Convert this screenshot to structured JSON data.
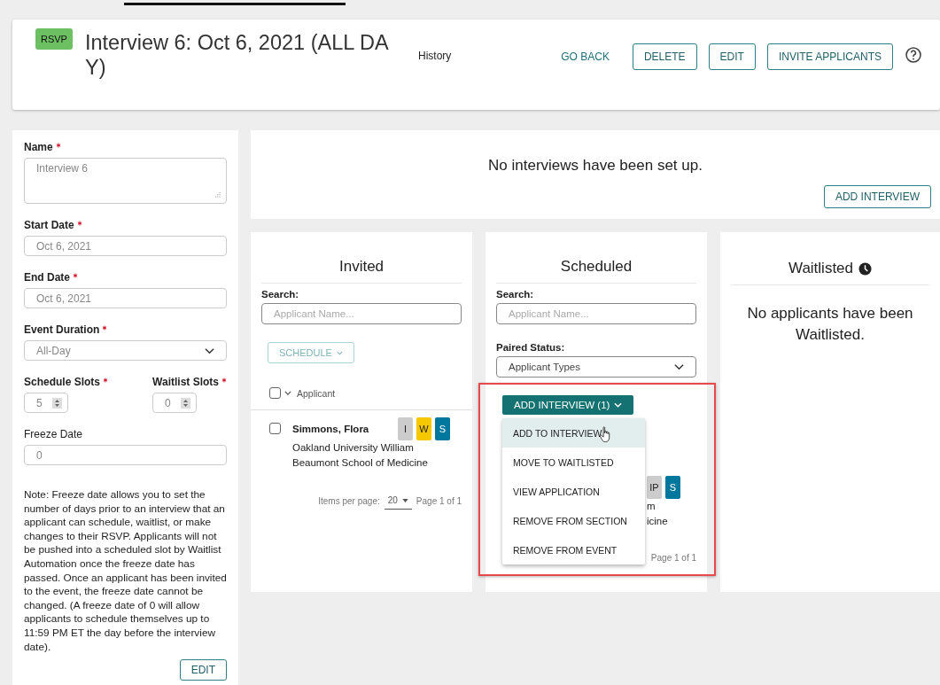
{
  "header": {
    "badge": "RSVP",
    "title": "Interview 6: Oct 6, 2021 (ALL DAY)",
    "history": "History",
    "go_back": "GO BACK",
    "buttons": [
      "DELETE",
      "EDIT",
      "INVITE APPLICANTS"
    ]
  },
  "form": {
    "fields": [
      {
        "kind": "textarea",
        "label": "Name",
        "required": true,
        "value": "Interview 6"
      },
      {
        "kind": "input",
        "label": "Start Date",
        "required": true,
        "value": "Oct 6, 2021"
      },
      {
        "kind": "input",
        "label": "End Date",
        "required": true,
        "value": "Oct 6, 2021"
      },
      {
        "kind": "select",
        "label": "Event Duration",
        "required": true,
        "value": "All-Day"
      }
    ],
    "slots": [
      {
        "label": "Schedule Slots",
        "required": true,
        "value": "5"
      },
      {
        "label": "Waitlist Slots",
        "required": true,
        "value": "0"
      }
    ],
    "freeze": {
      "label": "Freeze Date",
      "value": "0"
    },
    "note": "Note: Freeze date allows you to set the number of days prior to an interview that an applicant can schedule, waitlist, or make changes to their RSVP. Applicants will not be pushed into a scheduled slot by Waitlist Automation once the freeze date has passed. Once an applicant has been invited to the event, the freeze date cannot be changed. (A freeze date of 0 will allow applicants to schedule themselves up to 11:59 PM ET the day before the interview date).",
    "edit": "EDIT"
  },
  "interviews": {
    "message": "No interviews have been set up.",
    "button": "ADD INTERVIEW"
  },
  "invited": {
    "title": "Invited",
    "search_label": "Search:",
    "search_placeholder": "Applicant Name...",
    "schedule_button": "SCHEDULE",
    "column": "Applicant",
    "select_all_checked": false,
    "rows": [
      {
        "name": "Simmons, Flora",
        "school": "Oakland University William Beaumont School of Medicine",
        "checked": false,
        "tags": [
          {
            "text": "I",
            "color": "#cccccc"
          },
          {
            "text": "W",
            "color": "#f5c800"
          },
          {
            "text": "S",
            "color": "#00789e"
          }
        ]
      }
    ],
    "items_per_page_label": "Items per page:",
    "items_per_page": "20",
    "page": "Page 1 of 1"
  },
  "scheduled": {
    "title": "Scheduled",
    "search_label": "Search:",
    "search_placeholder": "Applicant Name...",
    "paired_label": "Paired Status:",
    "paired_value": "Applicant Types",
    "action_button": "ADD INTERVIEW (1)",
    "menu": [
      {
        "label": "ADD TO INTERVIEW",
        "selected": true
      },
      {
        "label": "MOVE TO WAITLISTED",
        "selected": false
      },
      {
        "label": "VIEW APPLICATION",
        "selected": false
      },
      {
        "label": "REMOVE FROM SECTION",
        "selected": false
      },
      {
        "label": "REMOVE FROM EVENT",
        "selected": false
      }
    ],
    "row": {
      "tags": [
        {
          "text": "IP",
          "color": "#cccccc"
        },
        {
          "text": "S",
          "color": "#00789e"
        }
      ],
      "fragments": [
        "m",
        "icine"
      ]
    },
    "page": "Page 1 of 1"
  },
  "waitlisted": {
    "title": "Waitlisted",
    "message": "No applicants have been Waitlisted."
  }
}
